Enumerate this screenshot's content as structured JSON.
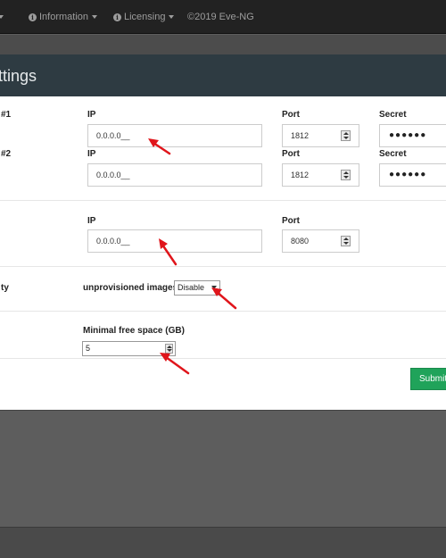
{
  "navbar": {
    "items": [
      {
        "label": "",
        "has_caret": true
      },
      {
        "label": "Information",
        "icon": "info-icon",
        "has_caret": true
      },
      {
        "label": "Licensing",
        "icon": "info-icon",
        "has_caret": true
      },
      {
        "label": "©2019 Eve-NG"
      }
    ]
  },
  "panel": {
    "title": "ttings"
  },
  "radius": {
    "server1_label": "#1",
    "server2_label": "#2",
    "ip_label": "IP",
    "port_label": "Port",
    "secret_label": "Secret",
    "server1": {
      "ip": "0.0.0.0__",
      "port": "1812",
      "secret": "●●●●●●"
    },
    "server2": {
      "ip": "0.0.0.0__",
      "port": "1812",
      "secret": "●●●●●●"
    }
  },
  "proxy": {
    "ip_label": "IP",
    "port_label": "Port",
    "ip": "0.0.0.0__",
    "port": "8080"
  },
  "security": {
    "row_label": "ty",
    "images_label": "unprovisioned images",
    "images_value": "Disable"
  },
  "disk": {
    "label": "Minimal free space (GB)",
    "value": "5"
  },
  "submit_label": "Submit",
  "colors": {
    "navbar": "#222222",
    "panel_header": "#2e3b42",
    "submit": "#20a35a",
    "annotation_arrow": "#e0151b"
  }
}
